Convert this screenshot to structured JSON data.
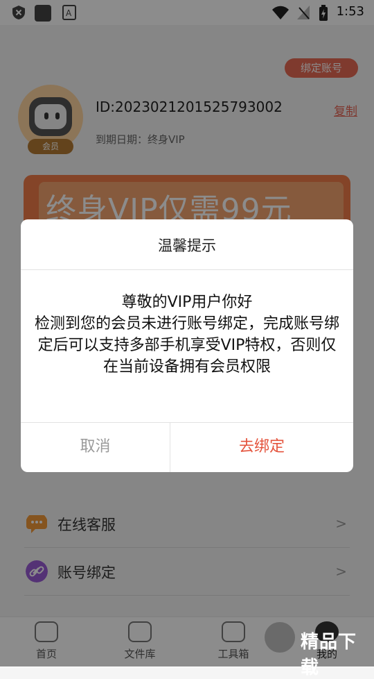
{
  "status_bar": {
    "time": "1:53"
  },
  "header": {
    "bind_account_label": "绑定账号"
  },
  "profile": {
    "id_text": "ID:2023021201525793002",
    "copy_label": "复制",
    "expire_text": "到期日期：终身VIP",
    "member_badge": "会员"
  },
  "promo": {
    "banner_text": "终身VIP仅需99元"
  },
  "menu": {
    "items": [
      {
        "label": "在线客服",
        "icon": "chat-icon",
        "color": "#f39a3a"
      },
      {
        "label": "账号绑定",
        "icon": "link-icon",
        "color": "#9a5cd6"
      }
    ]
  },
  "bottom_nav": {
    "items": [
      {
        "label": "首页"
      },
      {
        "label": "文件库"
      },
      {
        "label": "工具箱"
      },
      {
        "label": "我的"
      }
    ]
  },
  "dialog": {
    "title": "温馨提示",
    "line1": "尊敬的VIP用户你好",
    "line2": "检测到您的会员未进行账号绑定，完成账号绑定后可以支持多部手机享受VIP特权，否则仅在当前设备拥有会员权限",
    "cancel_label": "取消",
    "confirm_label": "去绑定"
  },
  "watermark": {
    "text": "精品下载"
  }
}
